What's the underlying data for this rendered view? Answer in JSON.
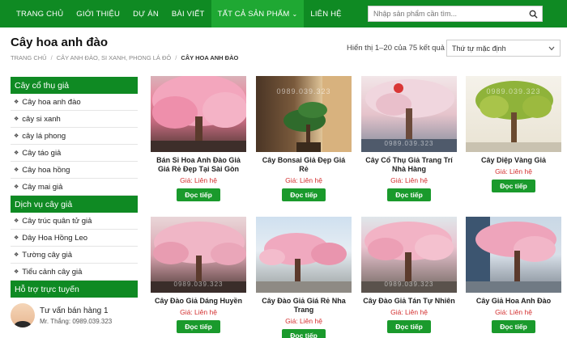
{
  "nav": {
    "items": [
      {
        "label": "TRANG CHỦ"
      },
      {
        "label": "GIỚI THIỆU"
      },
      {
        "label": "DỰ ÁN"
      },
      {
        "label": "BÀI VIẾT"
      },
      {
        "label": "TẤT CẢ SẢN PHẨM"
      },
      {
        "label": "LIÊN HỆ"
      }
    ],
    "active_index": 4,
    "search_placeholder": "Nhập sản phẩm cần tìm..."
  },
  "page": {
    "title": "Cây hoa anh đào",
    "breadcrumb": [
      "TRANG CHỦ",
      "/",
      "CÂY ANH ĐÀO, SI XANH, PHONG LÁ ĐỎ",
      "/",
      "CÂY HOA ANH ĐÀO"
    ],
    "result_count": "Hiển thị 1–20 của 75 kết quả",
    "sort_value": "Thứ tự mặc định"
  },
  "sidebar": {
    "group1_title": "Cây cổ thụ giả",
    "group1_items": [
      "Cây hoa anh đào",
      "cây si xanh",
      "cây lá phong",
      "Cây táo giả",
      "Cây hoa hồng",
      "Cây mai giả"
    ],
    "group2_title": "Dịch vụ cây giả",
    "group2_items": [
      "Cây trúc quân tử giả",
      "Dây Hoa Hồng Leo",
      "Tường cây giả",
      "Tiểu cảnh cây giả"
    ],
    "support_title": "Hỗ trợ trực tuyến",
    "support_name": "Tư vấn bán hàng 1",
    "support_phone": "Mr. Thắng: 0989.039.323"
  },
  "watermark": "0989.039.323",
  "products": [
    {
      "name": "Bán Sỉ Hoa Anh Đào Giả Giá Rẻ Đẹp Tại Sài Gòn",
      "price": "Giá: Liên hệ",
      "button": "Đọc tiếp"
    },
    {
      "name": "Cây Bonsai Giả Đẹp Giá Rẻ",
      "price": "Giá: Liên hệ",
      "button": "Đọc tiếp"
    },
    {
      "name": "Cây Cổ Thụ Giả Trang Trí Nhà Hàng",
      "price": "Giá: Liên hệ",
      "button": "Đọc tiếp"
    },
    {
      "name": "Cây Diệp Vàng Giả",
      "price": "Giá: Liên hệ",
      "button": "Đọc tiếp"
    },
    {
      "name": "Cây Đào Giả Dáng Huyền",
      "price": "Giá: Liên hệ",
      "button": "Đọc tiếp"
    },
    {
      "name": "Cây Đào Giả Giá Rẻ Nha Trang",
      "price": "Giá: Liên hệ",
      "button": "Đọc tiếp"
    },
    {
      "name": "Cây Đào Giả Tán Tự Nhiên",
      "price": "Giá: Liên hệ",
      "button": "Đọc tiếp"
    },
    {
      "name": "Cây Giả Hoa Anh Đào",
      "price": "Giá: Liên hệ",
      "button": "Đọc tiếp"
    }
  ],
  "colors": {
    "brand_green": "#0f8a23",
    "button_green": "#1a9a2c",
    "price_red": "#d32f2f"
  }
}
